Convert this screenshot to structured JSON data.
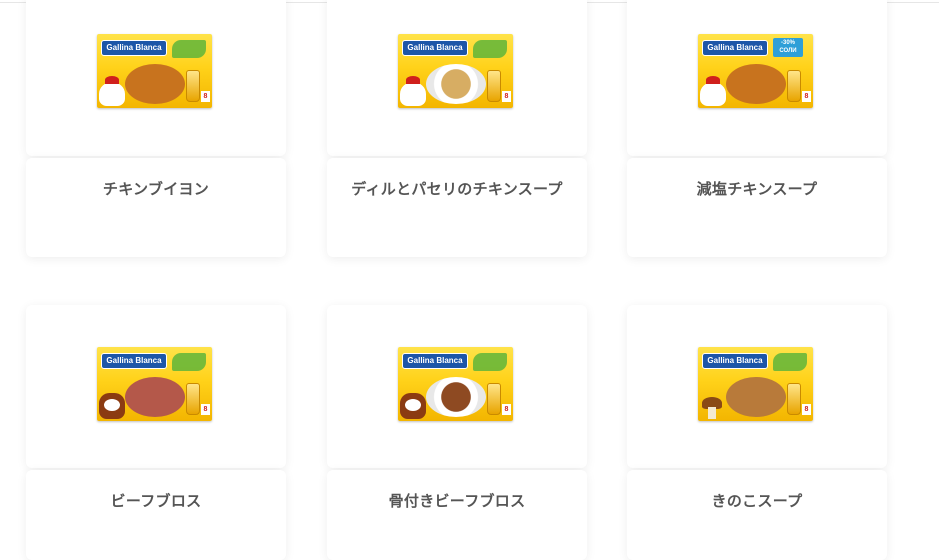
{
  "products": [
    {
      "title": "チキンブイヨン",
      "brand": "Gallina Blanca",
      "variant": "chicken",
      "has_sale_badge": false,
      "food_color": "#c8731e"
    },
    {
      "title": "ディルとパセリのチキンスープ",
      "brand": "Gallina Blanca",
      "variant": "chicken",
      "has_sale_badge": false,
      "food_color": "#c79b4a"
    },
    {
      "title": "減塩チキンスープ",
      "brand": "Gallina Blanca",
      "variant": "chicken",
      "has_sale_badge": true,
      "sale_label": "-30% СОЛИ",
      "food_color": "#c8731e"
    },
    {
      "title": "ビーフブロス",
      "brand": "Gallina Blanca",
      "variant": "beef",
      "has_sale_badge": false,
      "food_color": "#b4584a"
    },
    {
      "title": "骨付きビーフブロス",
      "brand": "Gallina Blanca",
      "variant": "beef",
      "has_sale_badge": false,
      "food_color": "#8e4a22"
    },
    {
      "title": "きのこスープ",
      "brand": "Gallina Blanca",
      "variant": "mushroom",
      "has_sale_badge": false,
      "food_color": "#b87a3a"
    }
  ],
  "pack_count_label": "8",
  "colors": {
    "title_text": "#555555",
    "card_bg": "#ffffff",
    "brand_blue": "#1d56a8",
    "pack_yellow": "#ffd21a"
  }
}
